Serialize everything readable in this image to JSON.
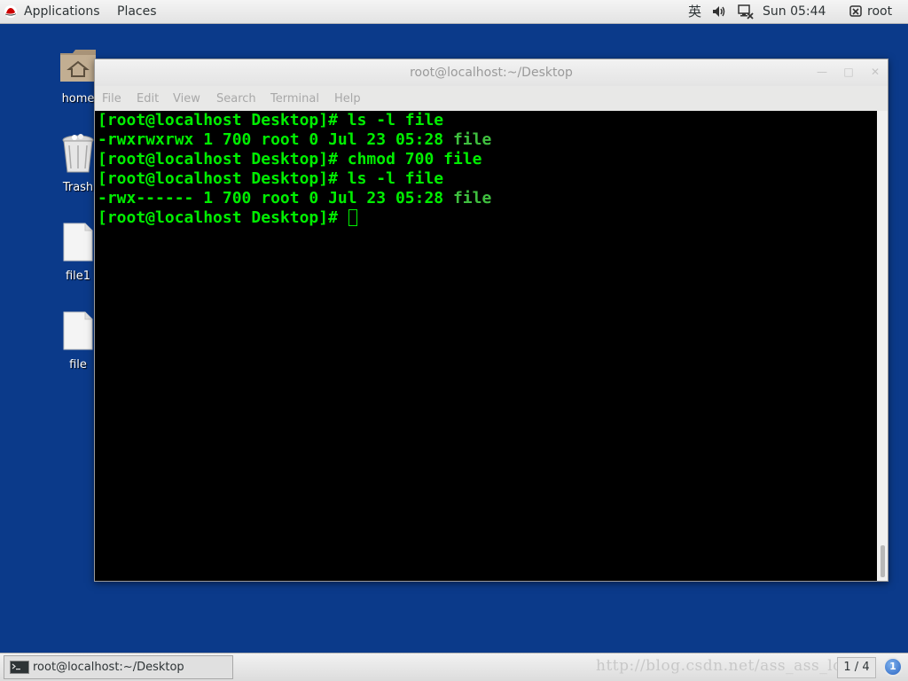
{
  "top_panel": {
    "applications_label": "Applications",
    "places_label": "Places",
    "ime_label": "英",
    "clock": "Sun 05:44",
    "user": "root"
  },
  "desktop": {
    "icons": [
      {
        "label": "home",
        "icon": "home-folder-icon"
      },
      {
        "label": "Trash",
        "icon": "trash-icon"
      },
      {
        "label": "file1",
        "icon": "file-icon"
      },
      {
        "label": "file",
        "icon": "file-icon"
      }
    ]
  },
  "terminal_window": {
    "title": "root@localhost:~/Desktop",
    "menu": [
      "File",
      "Edit",
      "View",
      "Search",
      "Terminal",
      "Help"
    ],
    "lines": [
      {
        "text": "[root@localhost Desktop]# ls -l file",
        "filename": ""
      },
      {
        "text": "-rwxrwxrwx 1 700 root 0 Jul 23 05:28 ",
        "filename": "file"
      },
      {
        "text": "[root@localhost Desktop]# chmod 700 file",
        "filename": ""
      },
      {
        "text": "[root@localhost Desktop]# ls -l file",
        "filename": ""
      },
      {
        "text": "-rwx------ 1 700 root 0 Jul 23 05:28 ",
        "filename": "file"
      },
      {
        "text": "[root@localhost Desktop]# ",
        "filename": ""
      }
    ],
    "colors": {
      "text": "#00ee00",
      "filename": "#3fbf3f",
      "background": "#000000"
    }
  },
  "bottom_panel": {
    "task_label": "root@localhost:~/Desktop",
    "watermark": "http://blog.csdn.net/ass_ass_lost",
    "workspace": "1 / 4",
    "notification_count": "1"
  },
  "theme": {
    "desktop_background": "#0b3a8a"
  }
}
